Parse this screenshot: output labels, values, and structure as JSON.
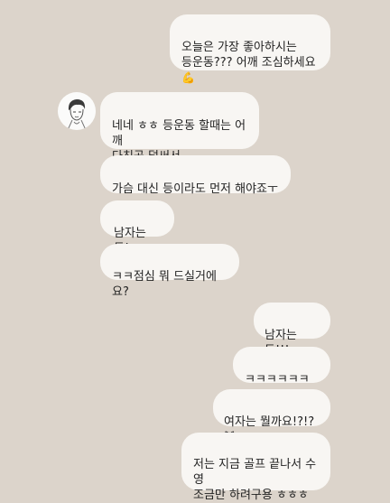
{
  "chat": {
    "messages": [
      {
        "id": "m1",
        "sender": "me",
        "text": "오늘은 가장 좋아하시는\n등운동??? 어깨 조심하세요",
        "emoji": "💪"
      },
      {
        "id": "m2",
        "sender": "them",
        "text": "네네 ㅎㅎ 등운동 할때는 어깨\n다친곳 덜써서"
      },
      {
        "id": "m3",
        "sender": "them",
        "text": "가슴 대신 등이라도 먼저 해야죠ㅜㅜ"
      },
      {
        "id": "m4",
        "sender": "them",
        "text": "남자는 등!"
      },
      {
        "id": "m5",
        "sender": "them",
        "text": "ㅋㅋ점심 뭐 드실거에요?"
      },
      {
        "id": "m6",
        "sender": "me",
        "text": "남자는 등!!!"
      },
      {
        "id": "m7",
        "sender": "me",
        "text": "ㅋㅋㅋㅋㅋㅋㅋ"
      },
      {
        "id": "m8",
        "sender": "me",
        "text": "여자는 뭘까요!?!?",
        "emoji": "😻"
      },
      {
        "id": "m9",
        "sender": "me",
        "text": "저는 지금 골프 끝나서 수영\n조금만 하려구용 ㅎㅎㅎ"
      }
    ]
  },
  "colors": {
    "background": "#dcd4cb",
    "bubble": "#f8f6f3",
    "text": "#222222"
  }
}
